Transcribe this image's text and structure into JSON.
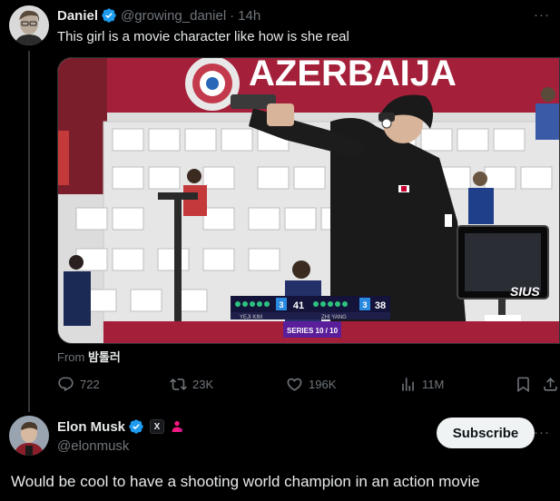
{
  "post": {
    "author_name": "Daniel",
    "author_handle": "@growing_daniel",
    "separator": "·",
    "time": "14h",
    "text": "This girl is a movie character like how is she real",
    "more_label": "···",
    "media": {
      "banner_text": "AZERBAIJA",
      "scoreboard": {
        "left_score": "41",
        "left_shots": "3",
        "right_score": "38",
        "right_shots": "3",
        "series_text": "SERIES 10 / 10",
        "left_name": "YEJI KIM",
        "right_name": "ZHI YANG"
      },
      "monitor_brand": "SIUS"
    },
    "from_label": "From",
    "from_name": "밤톨러",
    "actions": {
      "replies": "722",
      "reposts": "23K",
      "likes": "196K",
      "views": "11M"
    }
  },
  "reply": {
    "author_name": "Elon Musk",
    "author_handle": "@elonmusk",
    "x_badge": "X",
    "subscribe_label": "Subscribe",
    "more_label": "···",
    "text": "Would be cool to have a shooting world champion in an action movie"
  },
  "colors": {
    "background": "#000000",
    "verified": "#1d9bf0",
    "muted": "#71767b",
    "text": "#e7e9ea",
    "pink_badge": "#f91880"
  }
}
